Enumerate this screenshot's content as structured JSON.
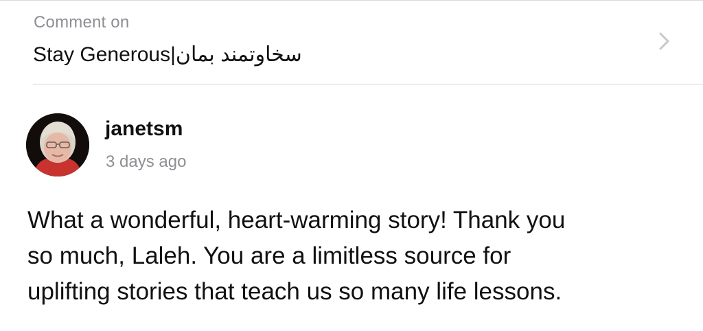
{
  "header": {
    "label": "Comment on",
    "title": "Stay Generous|سخاوتمند بمان",
    "chevron_icon": "chevron-right-icon"
  },
  "comment": {
    "author": "janetsm",
    "timestamp": "3 days ago",
    "avatar_icon": "user-avatar",
    "body_lines": [
      "What a wonderful, heart-warming story! Thank you",
      "so much, Laleh. You are a limitless source for",
      "uplifting stories that teach us so many life lessons."
    ]
  },
  "colors": {
    "secondary_text": "#8e8e93",
    "primary_text": "#111111",
    "divider": "#d4d4d8",
    "chevron": "#c7c7cc"
  }
}
